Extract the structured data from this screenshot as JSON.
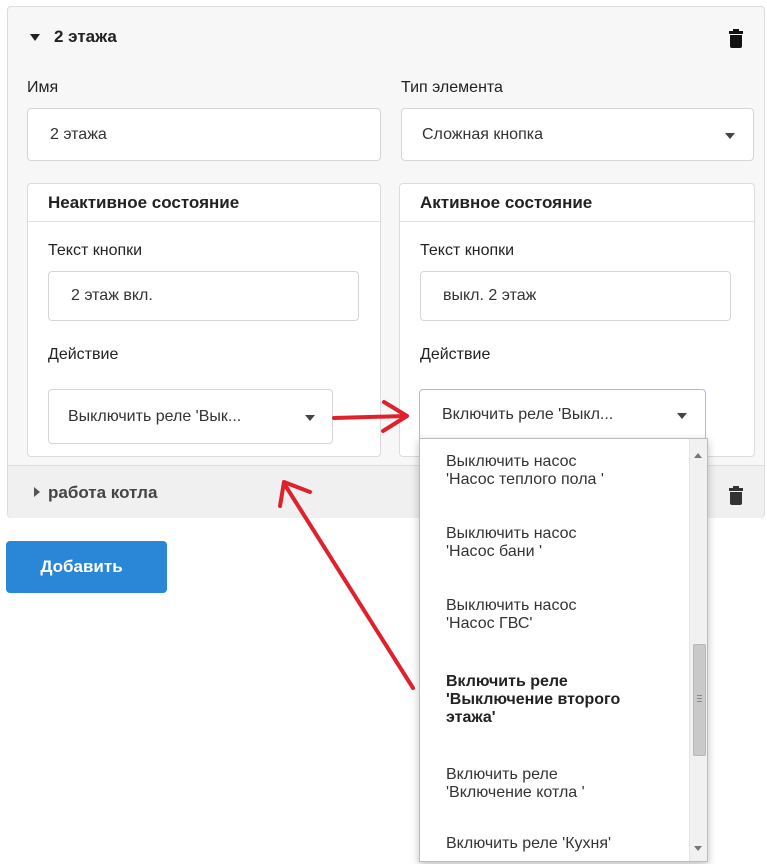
{
  "section_expanded": {
    "title": "2 этажа"
  },
  "name_field": {
    "label": "Имя",
    "value": "2 этажа"
  },
  "type_field": {
    "label": "Тип элемента",
    "value": "Сложная кнопка"
  },
  "inactive_card": {
    "title": "Неактивное состояние",
    "text_label": "Текст кнопки",
    "text_value": "2 этаж вкл.",
    "action_label": "Действие",
    "action_value": "Выключить реле 'Вык..."
  },
  "active_card": {
    "title": "Активное состояние",
    "text_label": "Текст кнопки",
    "text_value": "выкл. 2 этаж",
    "action_label": "Действие",
    "action_value": "Включить реле 'Выкл..."
  },
  "section_collapsed": {
    "title": "работа котла"
  },
  "add_button": {
    "label": "Добавить"
  },
  "dropdown_options": [
    {
      "line1": "Выключить насос",
      "line2": "'Насос теплого пола '",
      "line3": "",
      "selected": false
    },
    {
      "line1": "Выключить насос",
      "line2": "'Насос бани '",
      "line3": "",
      "selected": false
    },
    {
      "line1": "Выключить насос",
      "line2": "'Насос ГВС'",
      "line3": "",
      "selected": false
    },
    {
      "line1": "Включить реле",
      "line2": "'Выключение второго",
      "line3": "этажа'",
      "selected": true
    },
    {
      "line1": "Включить реле",
      "line2": "'Включение котла '",
      "line3": "",
      "selected": false
    },
    {
      "line1": "Включить реле 'Кухня'",
      "line2": "",
      "line3": "",
      "selected": false
    }
  ],
  "colors": {
    "primary_button": "#2a86d6",
    "annotation_arrow": "#e0202a"
  }
}
